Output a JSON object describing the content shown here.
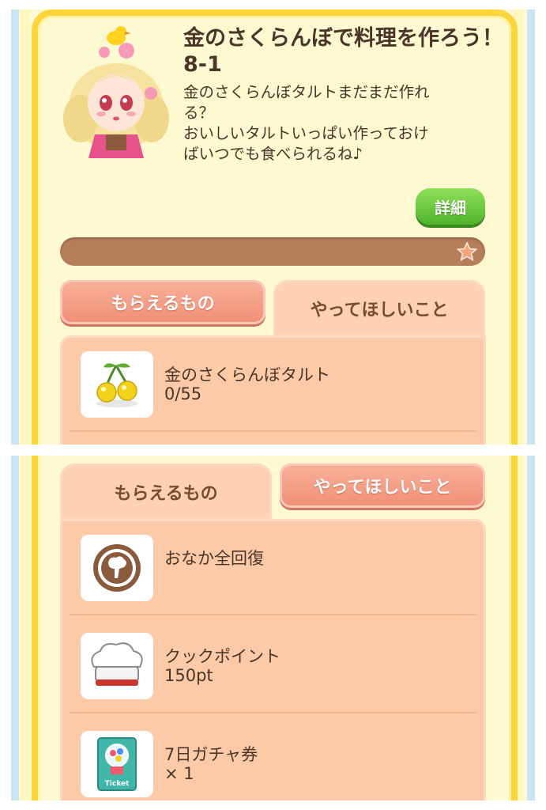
{
  "quest": {
    "title": "金のさくらんぼで料理を作ろう！8-1",
    "description_lines": [
      "金のさくらんぼタルトまだまだ作れ",
      "る？",
      "おいしいタルトいっぱい作っておけ",
      "ばいつでも食べられるね♪"
    ],
    "detail_button": "詳細"
  },
  "tabs": {
    "rewards": "もらえるもの",
    "tasks": "やってほしいこと"
  },
  "tasks_panel": {
    "items": [
      {
        "name": "金のさくらんぼタルト",
        "progress": "0/55",
        "icon": "golden-cherry-icon"
      }
    ]
  },
  "rewards_panel": {
    "items": [
      {
        "name": "おなか全回復",
        "detail": "",
        "icon": "hunger-restore-icon"
      },
      {
        "name": "クックポイント",
        "detail": "150pt",
        "icon": "chef-hat-icon"
      },
      {
        "name": "7日ガチャ券",
        "detail": "× 1",
        "icon": "gacha-ticket-icon"
      }
    ],
    "ticket_label": "Ticket"
  },
  "colors": {
    "frame": "#fbd53a",
    "panel": "#fccaa6",
    "progress_bar": "#b77e5a",
    "detail_button": "#5cc03a",
    "text": "#4a3528"
  }
}
